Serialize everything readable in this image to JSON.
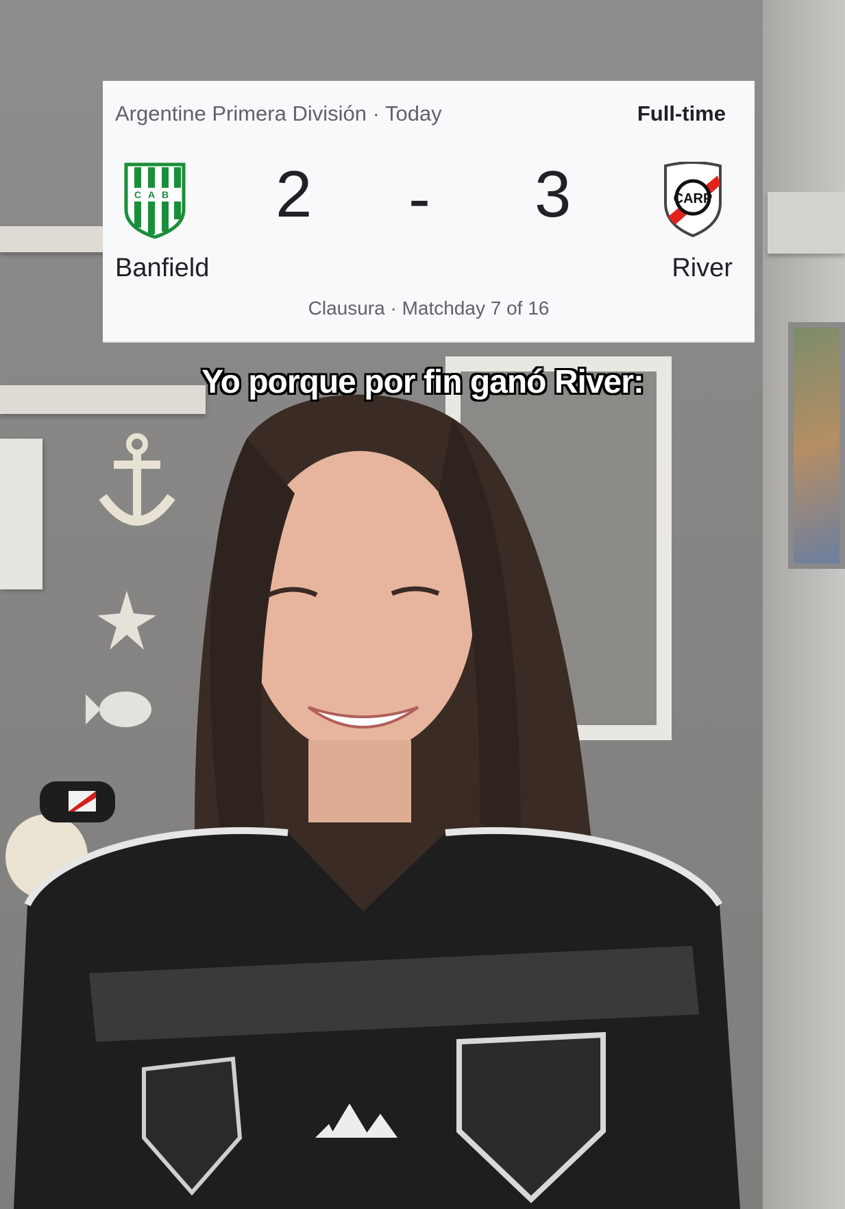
{
  "scorecard": {
    "league": "Argentine Primera División · Today",
    "status": "Full-time",
    "home": {
      "name": "Banfield",
      "score": "2",
      "crest_letters": "CAB",
      "colors": [
        "#1a8f3a",
        "#ffffff"
      ]
    },
    "separator": "-",
    "away": {
      "name": "River",
      "score": "3",
      "crest_letters": "CARP",
      "colors": [
        "#e2231a",
        "#ffffff"
      ]
    },
    "round": "Clausura · Matchday 7 of 16"
  },
  "caption": "Yo porque por fin ganó River:",
  "scene": {
    "jersey_brand": "adidas"
  }
}
